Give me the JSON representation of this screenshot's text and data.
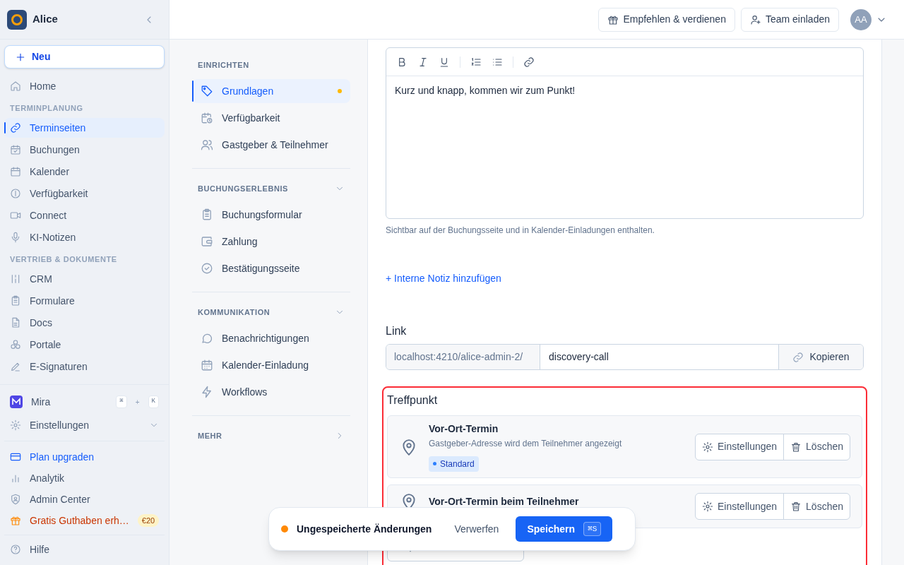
{
  "sidebar": {
    "workspace": "Alice",
    "new_button": "Neu",
    "sections": [
      {
        "items": [
          {
            "label": "Home",
            "selected": false
          }
        ]
      },
      {
        "title": "TERMINPLANUNG",
        "items": [
          {
            "label": "Terminseiten",
            "selected": true
          },
          {
            "label": "Buchungen",
            "selected": false
          },
          {
            "label": "Kalender",
            "selected": false
          },
          {
            "label": "Verfügbarkeit",
            "selected": false
          },
          {
            "label": "Connect",
            "selected": false
          },
          {
            "label": "KI-Notizen",
            "selected": false
          }
        ]
      },
      {
        "title": "VERTRIEB & DOKUMENTE",
        "items": [
          {
            "label": "CRM",
            "selected": false
          },
          {
            "label": "Formulare",
            "selected": false
          },
          {
            "label": "Docs",
            "selected": false
          },
          {
            "label": "Portale",
            "selected": false
          },
          {
            "label": "E-Signaturen",
            "selected": false
          }
        ]
      }
    ],
    "assistant": {
      "label": "Mira",
      "shortcut": [
        "⌘",
        "+",
        "K"
      ]
    },
    "settings": {
      "label": "Einstellungen",
      "expanded": false
    },
    "links": [
      {
        "kind": "upgrade",
        "label": "Plan upgraden"
      },
      {
        "kind": "plain",
        "label": "Analytik"
      },
      {
        "kind": "plain",
        "label": "Admin Center"
      },
      {
        "kind": "promo",
        "label": "Gratis Guthaben erh…",
        "badge": "€20"
      }
    ],
    "help": "Hilfe"
  },
  "header": {
    "buttons": [
      "Empfehlen & verdienen",
      "Team einladen"
    ],
    "avatar": "AA"
  },
  "settings_nav": {
    "sections": [
      {
        "title": "EINRICHTEN",
        "items": [
          {
            "label": "Grundlagen",
            "selected": true,
            "unsaved": true
          },
          {
            "label": "Verfügbarkeit",
            "selected": false,
            "unsaved": false
          },
          {
            "label": "Gastgeber & Teilnehmer",
            "selected": false,
            "unsaved": false
          }
        ]
      },
      {
        "title": "BUCHUNGSERLEBNIS",
        "expanded": true,
        "items": [
          {
            "label": "Buchungsformular",
            "selected": false,
            "unsaved": false
          },
          {
            "label": "Zahlung",
            "selected": false,
            "unsaved": false
          },
          {
            "label": "Bestätigungsseite",
            "selected": false,
            "unsaved": false
          }
        ]
      },
      {
        "title": "KOMMUNIKATION",
        "expanded": true,
        "items": [
          {
            "label": "Benachrichtigungen",
            "selected": false,
            "unsaved": false
          },
          {
            "label": "Kalender-Einladung",
            "selected": false,
            "unsaved": false
          },
          {
            "label": "Workflows",
            "selected": false,
            "unsaved": false
          }
        ]
      },
      {
        "title": "MEHR",
        "expanded": false
      }
    ]
  },
  "description": {
    "content": "Kurz und knapp, kommen wir zum Punkt!",
    "hint": "Sichtbar auf der Buchungsseite und in Kalender-Einladungen enthalten."
  },
  "internal_note_link": "+ Interne Notiz hinzufügen",
  "link": {
    "label": "Link",
    "prefix": "localhost:4210/alice-admin-2/",
    "value": "discovery-call",
    "copy_button": "Kopieren"
  },
  "meeting_place": {
    "title": "Treffpunkt",
    "highlighted": true,
    "options": [
      {
        "title": "Vor-Ort-Termin",
        "description": "Gastgeber-Adresse wird dem Teilnehmer angezeigt",
        "badge": "Standard",
        "actions": [
          "Einstellungen",
          "Löschen"
        ]
      },
      {
        "title": "Vor-Ort-Termin beim Teilnehmer",
        "actions": [
          "Einstellungen",
          "Löschen"
        ]
      }
    ]
  },
  "toast": {
    "message": "Ungespeicherte Änderungen",
    "discard": "Verwerfen",
    "save": "Speichern",
    "shortcut": "⌘S"
  }
}
